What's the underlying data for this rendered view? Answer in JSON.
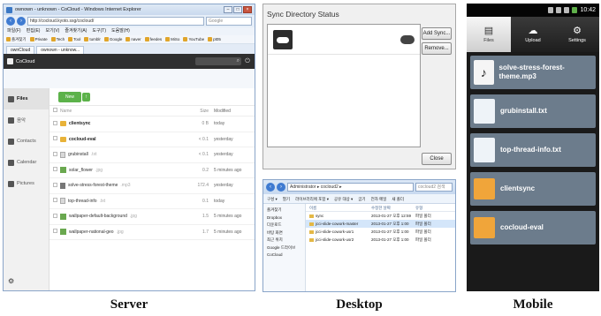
{
  "server": {
    "window_title": "ownown - unknown - CoCloud - Windows Internet Explorer",
    "url": "http://cocloud.kyoto.ssg/cocloud/",
    "search_placeholder": "Google",
    "menu": [
      "파일(F)",
      "편집(E)",
      "보기(V)",
      "즐겨찾기(A)",
      "도구(T)",
      "도움말(H)"
    ],
    "favorites": [
      "즐겨찾기",
      "Private",
      "Tech",
      "Tool",
      "tumblr",
      "Google",
      "naver",
      "feedes",
      "MiSo",
      "YouTube",
      "pt05"
    ],
    "tabs": [
      "ownCloud",
      "ownown - unknow..."
    ],
    "app_title": "CoCloud",
    "sidebar": [
      {
        "label": "Files",
        "icon": "files-icon",
        "active": true
      },
      {
        "label": "음악",
        "icon": "music-icon",
        "active": false
      },
      {
        "label": "Contacts",
        "icon": "contacts-icon",
        "active": false
      },
      {
        "label": "Calendar",
        "icon": "calendar-icon",
        "active": false
      },
      {
        "label": "Pictures",
        "icon": "pictures-icon",
        "active": false
      }
    ],
    "new_label": "New",
    "columns": {
      "name": "Name",
      "size": "Size",
      "modified": "Modified"
    },
    "files": [
      {
        "name": "clientsync",
        "ext": "",
        "type": "folder",
        "size": "0 B",
        "modified": "today",
        "bold": true
      },
      {
        "name": "cocloud-eval",
        "ext": "",
        "type": "folder",
        "size": "< 0.1",
        "modified": "yesterday",
        "bold": true
      },
      {
        "name": "grubinstall",
        "ext": ".txt",
        "type": "file",
        "size": "< 0.1",
        "modified": "yesterday",
        "bold": false
      },
      {
        "name": "solar_flower",
        "ext": ".jpg",
        "type": "image",
        "size": "0.2",
        "modified": "5 minutes ago",
        "bold": false
      },
      {
        "name": "solve-stress-forest-theme",
        "ext": ".mp3",
        "type": "music",
        "size": "172.4",
        "modified": "yesterday",
        "bold": false
      },
      {
        "name": "top-thread-info",
        "ext": ".txt",
        "type": "file",
        "size": "0.1",
        "modified": "today",
        "bold": false
      },
      {
        "name": "wallpaper-default-background",
        "ext": ".jpg",
        "type": "image",
        "size": "1.5",
        "modified": "5 minutes ago",
        "bold": false
      },
      {
        "name": "wallpaper-national-geo",
        "ext": ".jpg",
        "type": "image",
        "size": "1.7",
        "modified": "5 minutes ago",
        "bold": false
      }
    ]
  },
  "sync_dialog": {
    "title": "Sync Directory Status",
    "add_button": "Add Sync...",
    "remove_button": "Remove...",
    "close_button": "Close"
  },
  "explorer": {
    "path": "Administrator ▸ cocloud2 ▸",
    "search_placeholder": "cocloud2 검색",
    "toolbar": [
      "구성 ▾",
      "열기",
      "라이브러리에 포함 ▾",
      "공유 대상 ▾",
      "굽기",
      "전자 메일",
      "새 폴더"
    ],
    "nav": [
      "즐겨찾기",
      "Dropbox",
      "다운로드",
      "바탕 화면",
      "최근 위치",
      "Google 드라이브",
      "CoCloud"
    ],
    "columns": [
      "이름",
      "수정한 날짜",
      "유형"
    ],
    "rows": [
      {
        "name": "sync",
        "date": "2013-01-27 오후 12:59",
        "type": "파일 폴더",
        "selected": false
      },
      {
        "name": "jcci-slide-cowork-master",
        "date": "2013-01-27 오후 1:00",
        "type": "파일 폴더",
        "selected": true
      },
      {
        "name": "jcci-slide-cowork-usr1",
        "date": "2013-01-27 오후 1:00",
        "type": "파일 폴더",
        "selected": false
      },
      {
        "name": "jcci-slide-cowork-usr2",
        "date": "2013-01-27 오후 1:00",
        "type": "파일 폴더",
        "selected": false
      }
    ]
  },
  "mobile": {
    "time": "10:42",
    "tabs": [
      {
        "label": "Files",
        "icon": "files-icon",
        "glyph": "▤",
        "active": true
      },
      {
        "label": "Upload",
        "icon": "upload-cloud-icon",
        "glyph": "☁",
        "active": false
      },
      {
        "label": "Settings",
        "icon": "settings-icon",
        "glyph": "⚙",
        "active": false
      }
    ],
    "items": [
      {
        "name": "solve-stress-forest-theme.mp3",
        "icon": "music-file-icon",
        "kind": "music"
      },
      {
        "name": "grubinstall.txt",
        "icon": "text-file-icon",
        "kind": "doc"
      },
      {
        "name": "top-thread-info.txt",
        "icon": "text-file-icon",
        "kind": "doc"
      },
      {
        "name": "clientsync",
        "icon": "folder-icon",
        "kind": "folder"
      },
      {
        "name": "cocloud-eval",
        "icon": "folder-icon",
        "kind": "folder"
      }
    ]
  },
  "captions": {
    "server": "Server",
    "desktop": "Desktop",
    "mobile": "Mobile"
  }
}
